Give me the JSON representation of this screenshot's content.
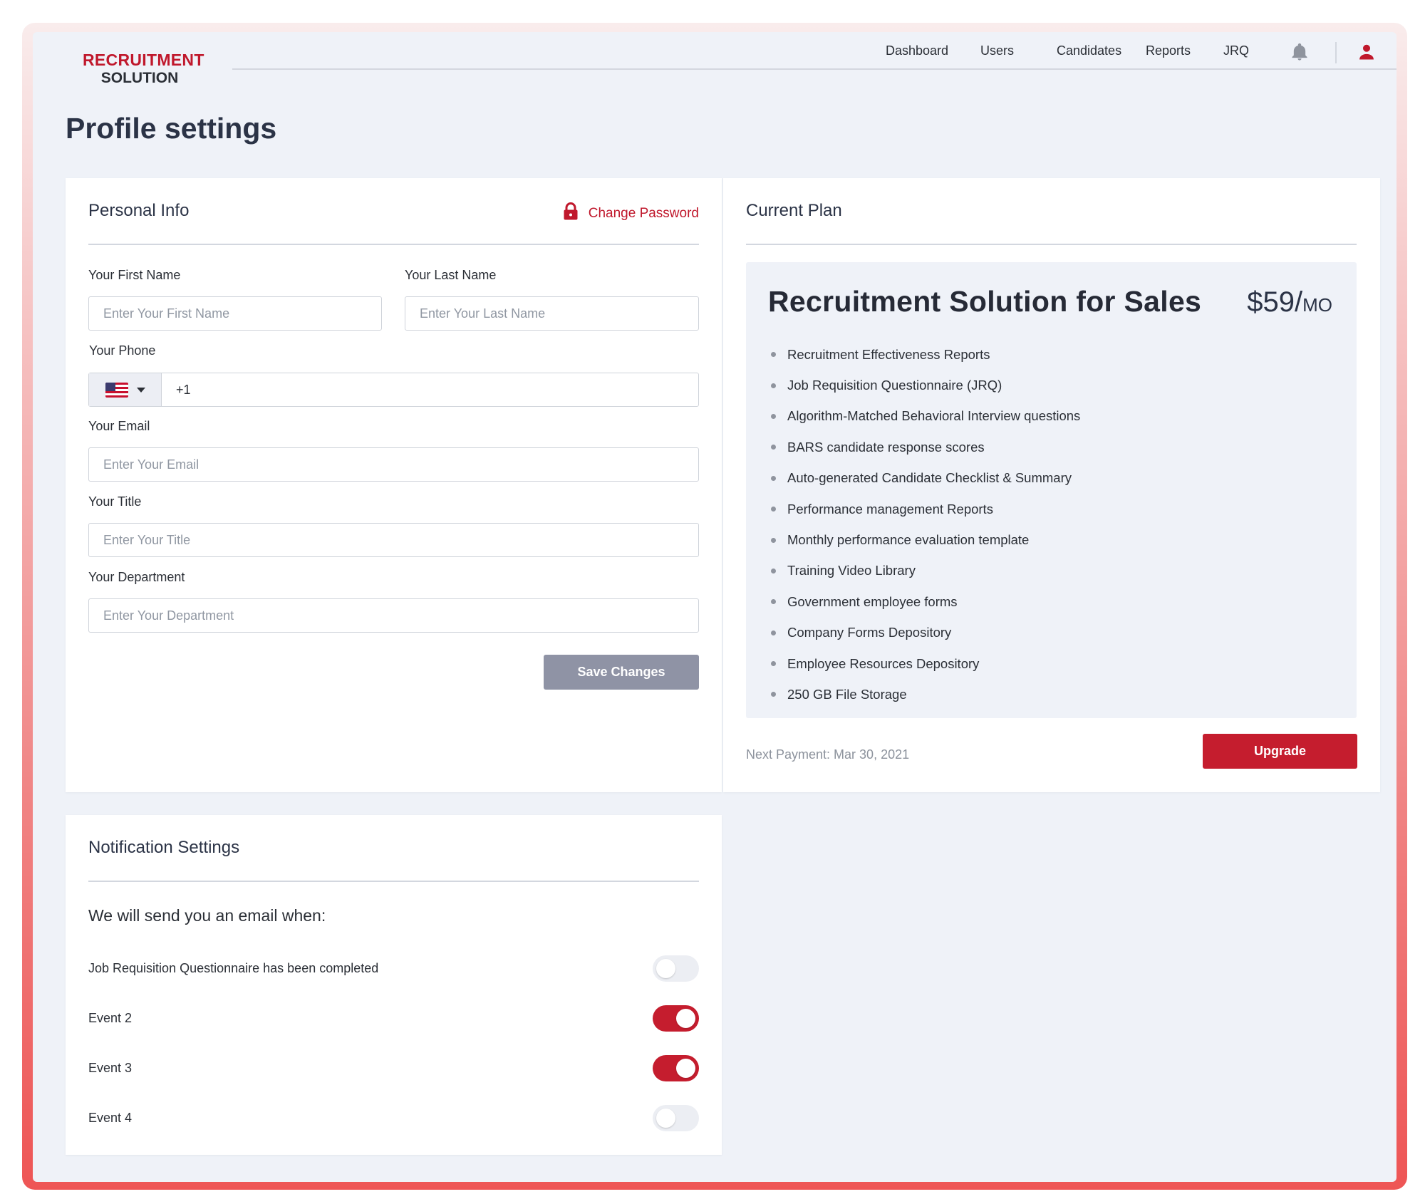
{
  "brand": {
    "line1": "RECRUITMENT",
    "line2": "SOLUTION"
  },
  "nav": {
    "items": [
      {
        "label": "Dashboard"
      },
      {
        "label": "Users"
      },
      {
        "label": "Candidates"
      },
      {
        "label": "Reports"
      },
      {
        "label": "JRQ"
      }
    ],
    "icons": [
      "bell-icon",
      "user-icon"
    ]
  },
  "page": {
    "title": "Profile settings"
  },
  "personal_info": {
    "title": "Personal Info",
    "change_password": "Change Password",
    "first_name": {
      "label": "Your First Name",
      "placeholder": "Enter Your First Name",
      "value": ""
    },
    "last_name": {
      "label": "Your Last Name",
      "placeholder": "Enter Your Last Name",
      "value": ""
    },
    "phone": {
      "label": "Your Phone",
      "country": "US",
      "code": "+1"
    },
    "email": {
      "label": "Your Email",
      "placeholder": "Enter Your Email",
      "value": ""
    },
    "title_field": {
      "label": "Your Title",
      "placeholder": "Enter Your Title",
      "value": ""
    },
    "department": {
      "label": "Your Department",
      "placeholder": "Enter Your Department",
      "value": ""
    },
    "save_label": "Save Changes"
  },
  "plan": {
    "title": "Current Plan",
    "name": "Recruitment Solution for Sales",
    "price": "$59/",
    "price_unit": "MO",
    "features": [
      "Recruitment Effectiveness Reports",
      "Job Requisition Questionnaire (JRQ)",
      "Algorithm-Matched Behavioral Interview questions",
      "BARS candidate response scores",
      "Auto-generated Candidate Checklist & Summary",
      "Performance management Reports",
      "Monthly performance evaluation template",
      "Training Video Library",
      "Government employee forms",
      "Company Forms Depository",
      "Employee Resources Depository",
      "250 GB File Storage"
    ],
    "next_payment": "Next Payment: Mar 30, 2021",
    "upgrade_label": "Upgrade"
  },
  "notifications": {
    "title": "Notification Settings",
    "subtitle": "We will send you an email when:",
    "events": [
      {
        "label": "Job Requisition Questionnaire has been completed",
        "enabled": false
      },
      {
        "label": "Event 2",
        "enabled": true
      },
      {
        "label": "Event 3",
        "enabled": true
      },
      {
        "label": "Event 4",
        "enabled": false
      }
    ]
  },
  "colors": {
    "accent": "#c51d2e",
    "brand_red": "#c0182c",
    "background": "#eff2f8",
    "save_button": "#8f93a5",
    "text_dark": "#2b3346"
  }
}
